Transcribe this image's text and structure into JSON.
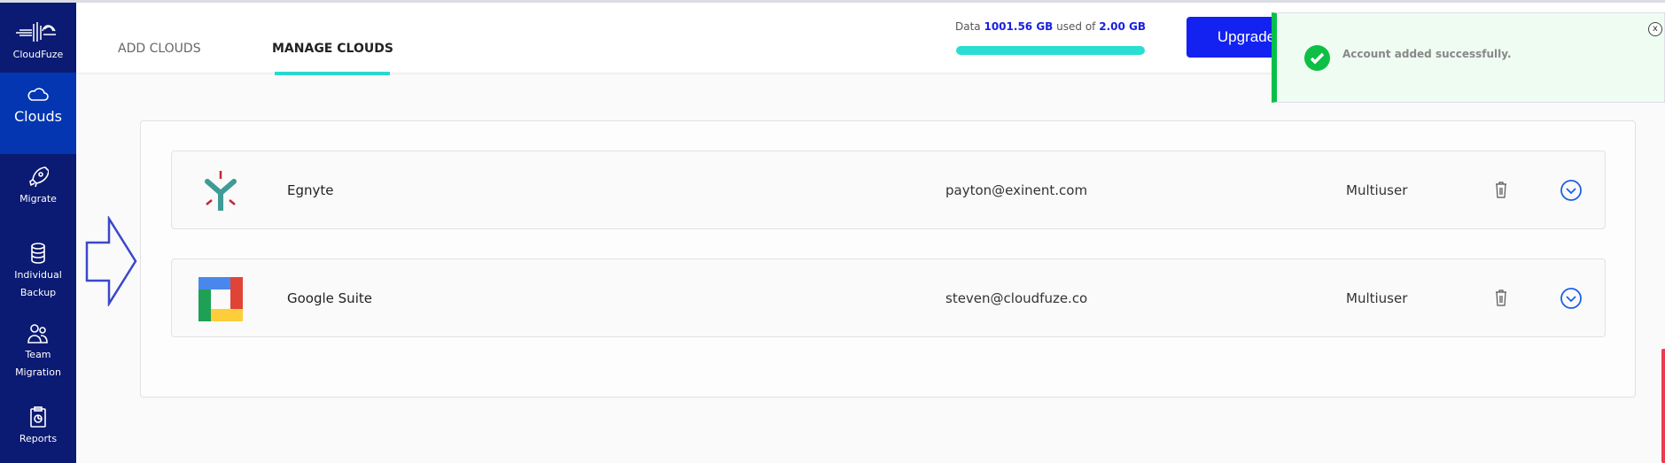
{
  "sidebar": {
    "brand": "CloudFuze",
    "items": [
      {
        "label": "Clouds",
        "icon": "cloud-icon",
        "active": true
      },
      {
        "label": "Migrate",
        "icon": "rocket-icon"
      },
      {
        "label_lines": [
          "Individual",
          "Backup"
        ],
        "icon": "database-icon"
      },
      {
        "label_lines": [
          "Team",
          "Migration"
        ],
        "icon": "users-icon"
      },
      {
        "label": "Reports",
        "icon": "clipboard-report-icon"
      }
    ]
  },
  "header": {
    "tabs": [
      {
        "label": "ADD CLOUDS"
      },
      {
        "label": "MANAGE CLOUDS",
        "active": true
      }
    ],
    "usage": {
      "prefix": "Data",
      "used": "1001.56 GB",
      "middle": "used of",
      "total": "2.00 GB",
      "bar_fill_percent": 100
    },
    "upgrade_label": "Upgrade"
  },
  "toast": {
    "message": "Account added successfully.",
    "close": "x",
    "status_color": "#08c049"
  },
  "clouds": [
    {
      "name": "Egnyte",
      "email": "payton@exinent.com",
      "type": "Multiuser",
      "logo": "egnyte-logo"
    },
    {
      "name": "Google Suite",
      "email": "steven@cloudfuze.co",
      "type": "Multiuser",
      "logo": "google-suite-logo"
    }
  ],
  "colors": {
    "sidebar": "#0b1a72",
    "active": "#0336b0",
    "accent": "#29d9cf",
    "upgrade": "#1322f0"
  }
}
